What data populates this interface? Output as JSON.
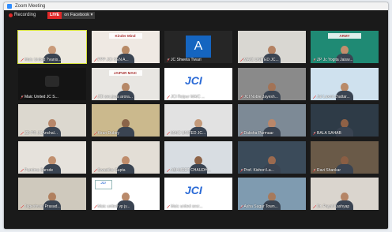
{
  "window": {
    "title": "Zoom Meeting"
  },
  "status": {
    "recording": "Recording",
    "live_badge": "LIVE",
    "live_destination": "on Facebook"
  },
  "colors": {
    "active_speaker": "#d6e23b",
    "live": "#e02828",
    "muted": "#e02828"
  },
  "participants": [
    {
      "name": "Maic United ?vanis...",
      "muted": true,
      "active": true,
      "bg": "#ece8df",
      "tone": "#c99b7a",
      "kind": "person"
    },
    {
      "name": "PPP JCI SEN A...",
      "muted": true,
      "bg": "#efe9e3",
      "tone": "#b88a66",
      "kind": "person",
      "banner": "Kinder Mind"
    },
    {
      "name": "JC Shweta Tiwari",
      "muted": true,
      "bg": "#262626",
      "kind": "avatar",
      "initial": "A"
    },
    {
      "name": "MAIC UNITED JC...",
      "muted": true,
      "bg": "#d9d7d2",
      "tone": "#b48263",
      "kind": "person"
    },
    {
      "name": "ZP Jc Yogita Jaisw...",
      "muted": true,
      "bg": "#1f8a74",
      "tone": "#c38d6c",
      "kind": "person",
      "banner": "ARMY"
    },
    {
      "name": "Maic United JC S...",
      "muted": true,
      "bg": "#141414",
      "kind": "dark"
    },
    {
      "name": "JCI sec.jaya arora...",
      "muted": true,
      "bg": "#e8e6e2",
      "tone": "#b68867",
      "kind": "person",
      "banner": "JAIPUR MAIC"
    },
    {
      "name": "JCI Raipur MAIC ...",
      "muted": true,
      "bg": "#ffffff",
      "kind": "logo"
    },
    {
      "name": "JCI Noble Jayesh...",
      "muted": true,
      "bg": "#8a8a8a",
      "tone": "#a27356",
      "kind": "person"
    },
    {
      "name": "Jai Laxmi chattar...",
      "muted": true,
      "bg": "#cfe1ee",
      "tone": "#b98a68",
      "kind": "person"
    },
    {
      "name": "ZD PR JCAnchal...",
      "muted": true,
      "bg": "#dcd8cf",
      "tone": "#b7876a",
      "kind": "person"
    },
    {
      "name": "Kiran Dubey",
      "muted": true,
      "bg": "#cbb98d",
      "tone": "#8a6449",
      "kind": "person"
    },
    {
      "name": "MAIC UNITED JC...",
      "muted": true,
      "bg": "#e2e2e2",
      "tone": "#c49a7a",
      "kind": "person"
    },
    {
      "name": "Daksha Parmaar",
      "muted": true,
      "bg": "#7d8a96",
      "tone": "#b9876a",
      "kind": "person"
    },
    {
      "name": "BALA SAHAB",
      "muted": true,
      "bg": "#2e3b47",
      "tone": "#8f6146",
      "kind": "person"
    },
    {
      "name": "Purnima Sarode",
      "muted": true,
      "bg": "#e6e2dc",
      "tone": "#c08f6e",
      "kind": "person"
    },
    {
      "name": "Swastika Gupta",
      "muted": true,
      "bg": "#e3ded6",
      "tone": "#bf8c6b",
      "kind": "person"
    },
    {
      "name": "ABHIJEET CHAUDH...",
      "muted": true,
      "bg": "#d8dde2",
      "tone": "#8e6448",
      "kind": "person"
    },
    {
      "name": "Prof. Kishori La...",
      "muted": true,
      "bg": "#3b4b5a",
      "tone": "#9b6a4f",
      "kind": "person"
    },
    {
      "name": "Ravi Shankar",
      "muted": true,
      "bg": "#6a5a48",
      "tone": "#8a5e44",
      "kind": "person"
    },
    {
      "name": "Jageshwar Prasad...",
      "muted": true,
      "bg": "#cfc9bd",
      "tone": "#b0805f",
      "kind": "person"
    },
    {
      "name": "Maic united vp jy...",
      "muted": true,
      "bg": "#ffffff",
      "tone": "#b98a6b",
      "kind": "logo-person"
    },
    {
      "name": "Maic united secr...",
      "muted": true,
      "bg": "#ffffff",
      "kind": "logo"
    },
    {
      "name": "Asha Sugar Town...",
      "muted": true,
      "bg": "#7f9bb0",
      "tone": "#a67a5c",
      "kind": "person"
    },
    {
      "name": "Dr. Payal Kashyap",
      "muted": true,
      "bg": "#dad5ce",
      "tone": "#b58566",
      "kind": "person"
    }
  ]
}
